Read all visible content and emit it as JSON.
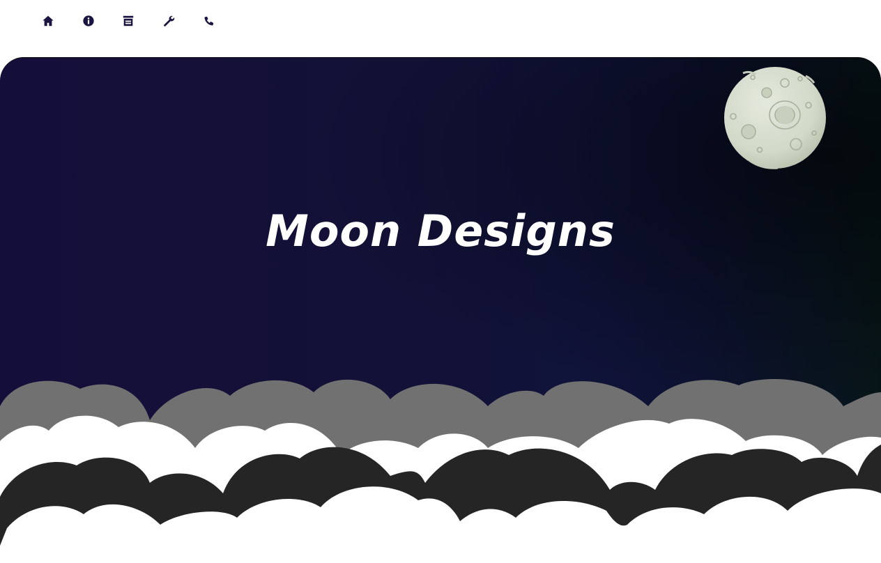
{
  "nav": {
    "items": [
      {
        "id": "home",
        "icon": "home-icon"
      },
      {
        "id": "info",
        "icon": "info-icon"
      },
      {
        "id": "portfolio",
        "icon": "archive-icon"
      },
      {
        "id": "services",
        "icon": "wrench-icon"
      },
      {
        "id": "contact",
        "icon": "phone-icon"
      }
    ],
    "icon_color": "#1a1440"
  },
  "hero": {
    "title": "Moon Designs",
    "moon_icon": "moon-icon",
    "colors": {
      "background_start": "#140f3a",
      "background_end": "#071518",
      "cloud_light": "#ffffff",
      "cloud_grey": "#717171",
      "cloud_dark": "#252525",
      "moon": "#d6dccd"
    }
  }
}
